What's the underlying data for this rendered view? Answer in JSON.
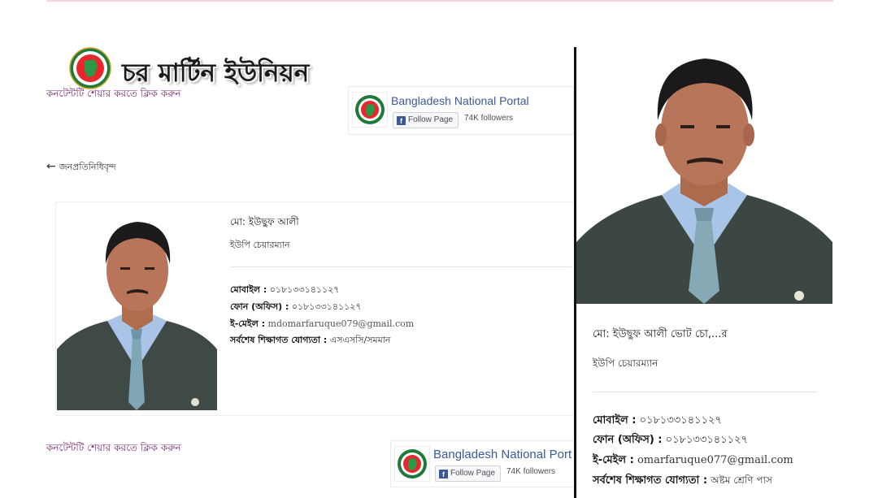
{
  "site": {
    "title": "চর মার্টিন ইউনিয়ন",
    "share_label": "কনটেন্টটি শেয়ার করতে ক্লিক করুন"
  },
  "facebook_widget": {
    "page_name_top": "Bangladesh National Portal",
    "page_name_bottom": "Bangladesh National Port",
    "follow_label": "Follow Page",
    "followers": "74K followers",
    "brand_color": "#3b5998"
  },
  "navigation": {
    "back_label": "জনপ্রতিনিধিবৃন্দ",
    "back_icon": "arrow-left-icon"
  },
  "profile_left": {
    "name": "মো: ইউছুফ আলী",
    "role": "ইউপি চেয়ারম্যান",
    "mobile_label": "মোবাইল :",
    "mobile": "০১৮১৩৩১৪১১২৭",
    "phone_label": "ফোন (অফিস) :",
    "phone": "০১৮১৩৩১৪১১২৭",
    "email_label": "ই-মেইল :",
    "email": "mdomarfaruque079@gmail.com",
    "edu_label": "সর্বশেষ শিক্ষাগত যোগ্যতা :",
    "edu": "এসএসসি/সমমান"
  },
  "profile_right": {
    "name": "মো: ইউছুফ আলী ভোট চো,...র",
    "role": "ইউপি চেয়ারম্যান",
    "mobile_label": "মোবাইল :",
    "mobile": "০১৮১৩৩১৪১১২৭",
    "phone_label": "ফোন (অফিস) :",
    "phone": "০১৮১৩৩১৪১১২৭",
    "email_label": "ই-মেইল :",
    "email": "omarfaruque077@gmail.com",
    "edu_label": "সর্বশেষ শিক্ষাগত যোগ্যতা :",
    "edu": "অষ্টম শ্রেণি পাস"
  }
}
